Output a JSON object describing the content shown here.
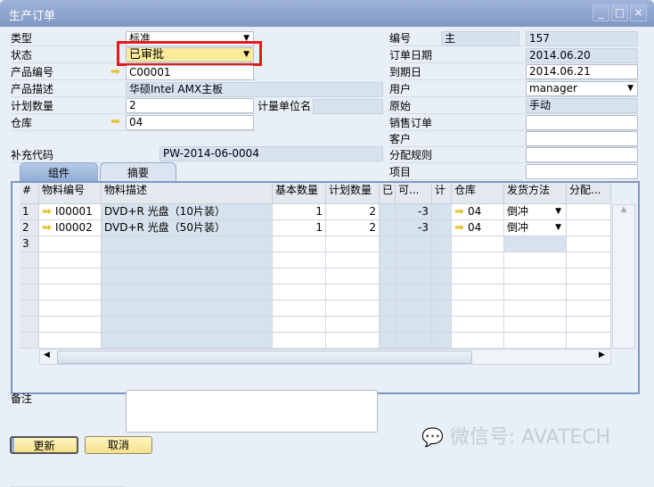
{
  "window": {
    "title": "生产订单",
    "minimize": "_",
    "maximize": "□",
    "close": "×"
  },
  "left": {
    "type": {
      "label": "类型",
      "value": "标准"
    },
    "status": {
      "label": "状态",
      "value": "已审批"
    },
    "product_no": {
      "label": "产品编号",
      "value": "C00001"
    },
    "product_desc": {
      "label": "产品描述",
      "value": "华硕Intel AMX主板"
    },
    "planned_qty": {
      "label": "计划数量",
      "value": "2"
    },
    "uom_label": "计量单位名",
    "uom_value": "",
    "warehouse": {
      "label": "仓库",
      "value": "04"
    },
    "supp_code": {
      "label": "补充代码",
      "value": "PW-2014-06-0004"
    }
  },
  "right": {
    "number": {
      "label": "编号",
      "series": "主",
      "value": "157"
    },
    "order_date": {
      "label": "订单日期",
      "value": "2014.06.20"
    },
    "due_date": {
      "label": "到期日",
      "value": "2014.06.21"
    },
    "user": {
      "label": "用户",
      "value": "manager"
    },
    "origin": {
      "label": "原始",
      "value": "手动"
    },
    "sales_order": {
      "label": "销售订单",
      "value": ""
    },
    "customer": {
      "label": "客户",
      "value": ""
    },
    "dist_rule": {
      "label": "分配规则",
      "value": ""
    },
    "project": {
      "label": "项目",
      "value": ""
    }
  },
  "tabs": [
    {
      "label": "组件"
    },
    {
      "label": "摘要"
    }
  ],
  "grid": {
    "columns": [
      "#",
      "物料编号",
      "物料描述",
      "基本数量",
      "计划数量",
      "已",
      "可...",
      "计",
      "仓库",
      "发货方法",
      "分配..."
    ],
    "rows": [
      [
        "1",
        "I00001",
        "DVD+R 光盘（10片装）",
        "1",
        "2",
        "",
        "-3",
        "",
        "04",
        "倒冲",
        ""
      ],
      [
        "2",
        "I00002",
        "DVD+R 光盘（50片装）",
        "1",
        "2",
        "",
        "-3",
        "",
        "04",
        "倒冲",
        ""
      ],
      [
        "3",
        "",
        "",
        "",
        "",
        "",
        "",
        "",
        "",
        "",
        ""
      ]
    ]
  },
  "remarks": {
    "label": "备注",
    "value": ""
  },
  "buttons": {
    "update": "更新",
    "cancel": "取消"
  },
  "watermark": "微信号: AVATECH",
  "colors": {
    "highlight": "#e8191a",
    "status_bg": "#fdeb9c",
    "arrow": "#e7c12f"
  }
}
